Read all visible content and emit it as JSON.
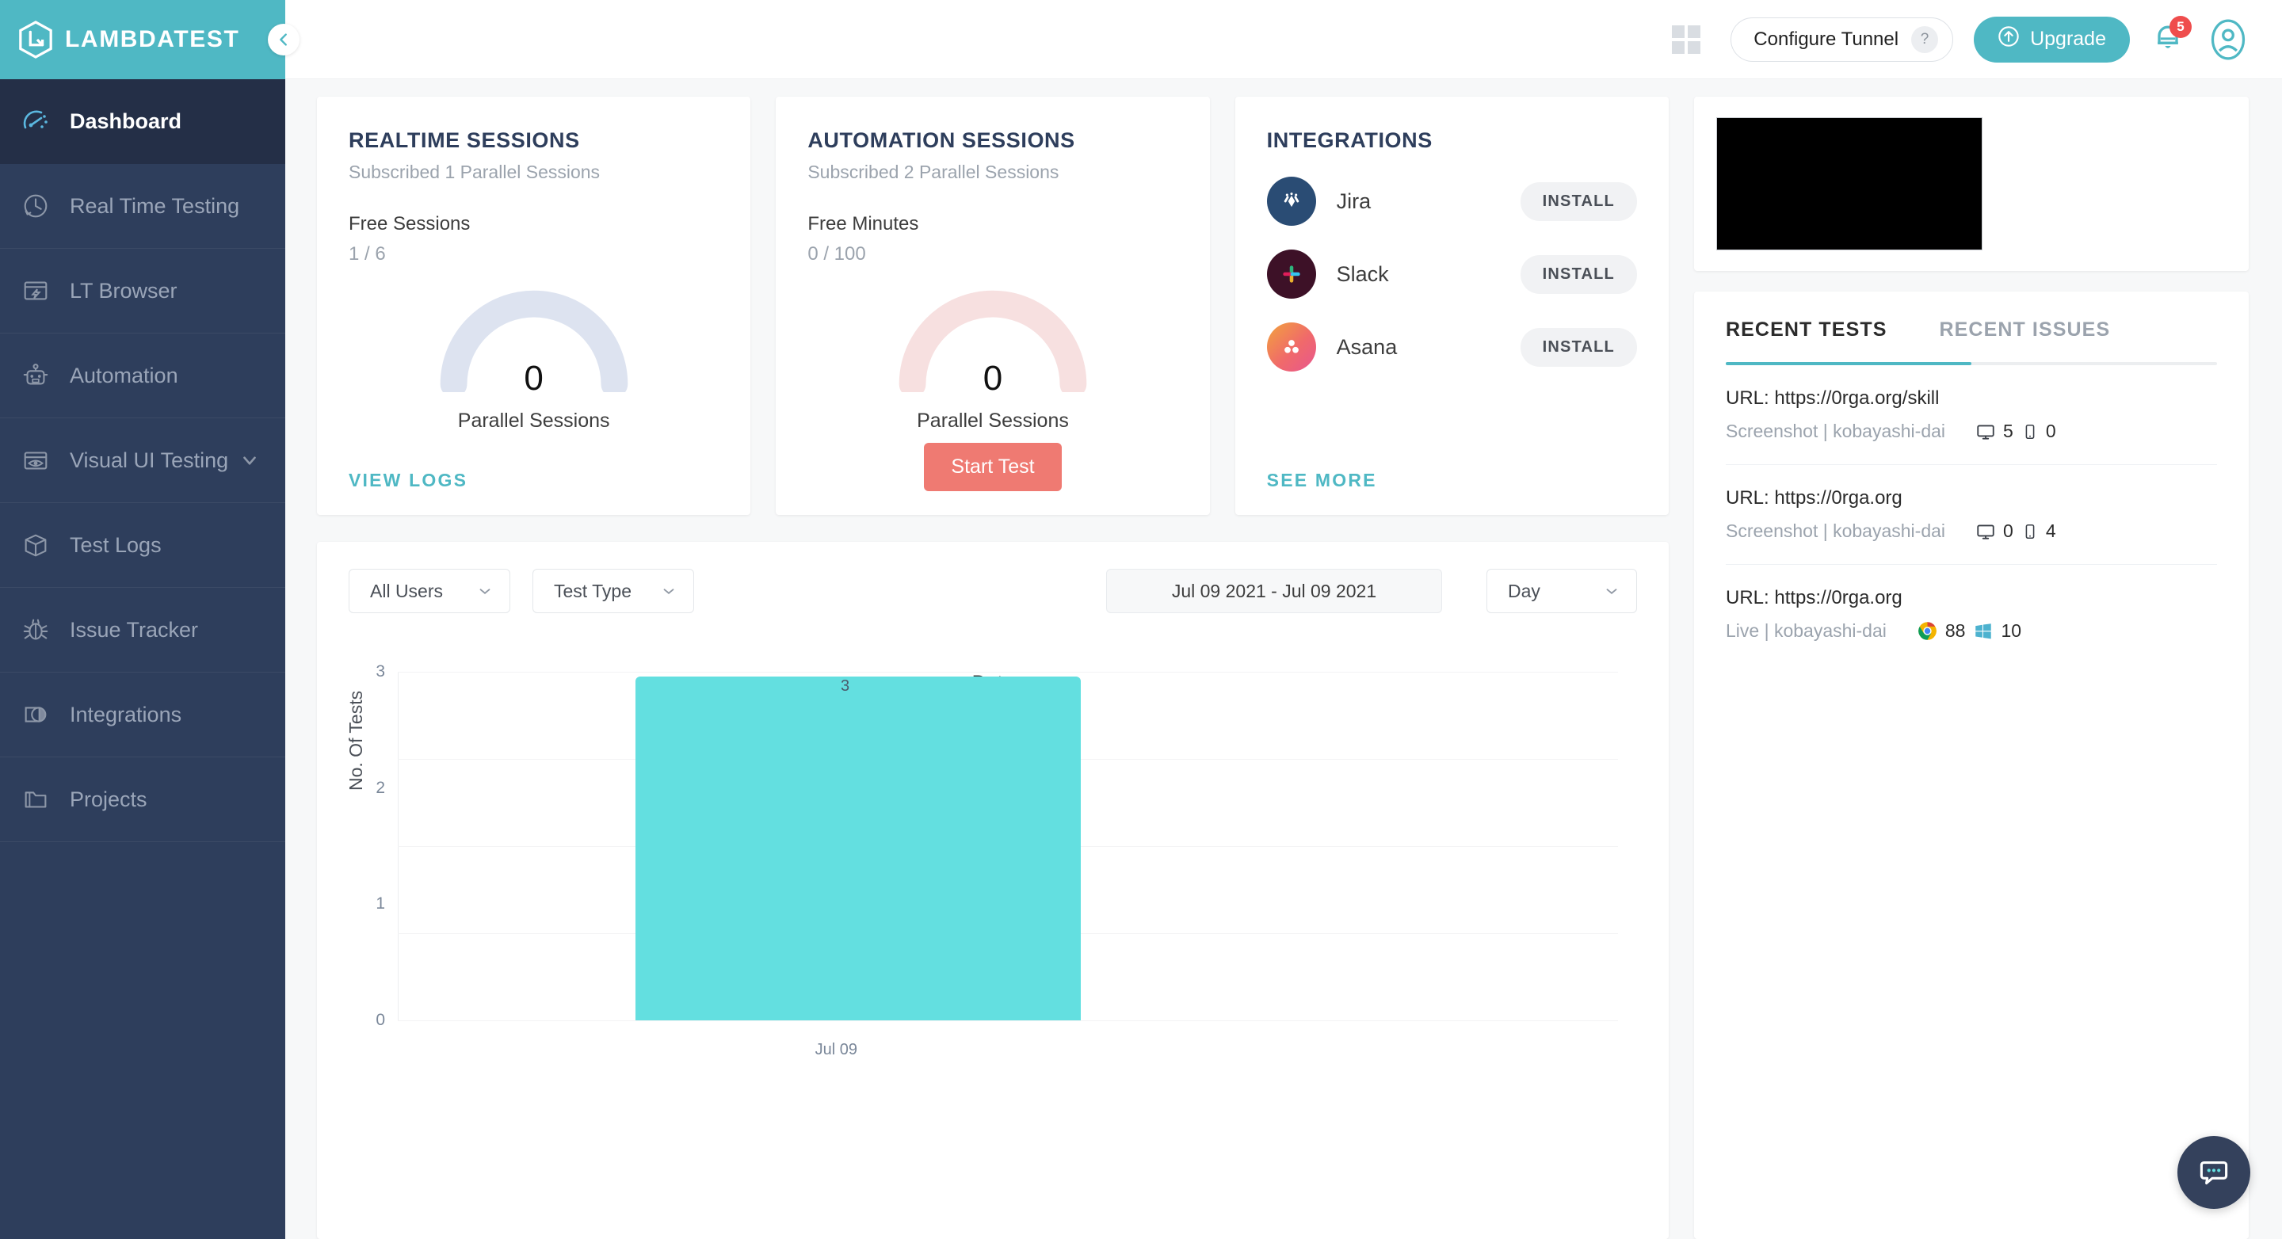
{
  "brand": {
    "name": "LAMBDATEST",
    "logo_icon": "lambdatest-cube-icon",
    "collapse_icon": "chevron-left-icon"
  },
  "sidebar": {
    "items": [
      {
        "label": "Dashboard",
        "icon": "speedometer-icon",
        "active": true
      },
      {
        "label": "Real Time Testing",
        "icon": "clock-icon",
        "active": false
      },
      {
        "label": "LT Browser",
        "icon": "browser-bolt-icon",
        "active": false
      },
      {
        "label": "Automation",
        "icon": "robot-icon",
        "active": false
      },
      {
        "label": "Visual UI Testing",
        "icon": "eye-browser-icon",
        "active": false,
        "caret": "chevron-down-icon"
      },
      {
        "label": "Test Logs",
        "icon": "box-icon",
        "active": false
      },
      {
        "label": "Issue Tracker",
        "icon": "bug-icon",
        "active": false
      },
      {
        "label": "Integrations",
        "icon": "integrations-icon",
        "active": false
      },
      {
        "label": "Projects",
        "icon": "folder-icon",
        "active": false
      }
    ]
  },
  "topbar": {
    "grid_icon": "grid-apps-icon",
    "tunnel_label": "Configure Tunnel",
    "tunnel_help": "?",
    "upgrade_label": "Upgrade",
    "upgrade_icon": "arrow-up-circle-icon",
    "bell_icon": "bell-icon",
    "bell_badge": "5",
    "avatar_icon": "user-avatar-icon",
    "accent_color": "#4fb8c4",
    "badge_color": "#ef4d4d"
  },
  "realtime_card": {
    "title": "REALTIME SESSIONS",
    "subtitle": "Subscribed 1 Parallel Sessions",
    "metric_label": "Free Sessions",
    "metric_value": "1 / 6",
    "gauge_number": "0",
    "gauge_caption": "Parallel Sessions",
    "gauge_color": "#dde3f0",
    "link_label": "VIEW LOGS"
  },
  "automation_card": {
    "title": "AUTOMATION SESSIONS",
    "subtitle": "Subscribed 2 Parallel Sessions",
    "metric_label": "Free Minutes",
    "metric_value": "0 / 100",
    "gauge_number": "0",
    "gauge_caption": "Parallel Sessions",
    "gauge_color": "#f7e0e0",
    "button_label": "Start Test",
    "button_color": "#ef7a72"
  },
  "integrations_card": {
    "title": "INTEGRATIONS",
    "items": [
      {
        "name": "Jira",
        "icon": "jira-logo-icon",
        "action": "INSTALL"
      },
      {
        "name": "Slack",
        "icon": "slack-logo-icon",
        "action": "INSTALL"
      },
      {
        "name": "Asana",
        "icon": "asana-logo-icon",
        "action": "INSTALL"
      }
    ],
    "see_more_label": "SEE MORE"
  },
  "filters": {
    "user_select": "All Users",
    "type_select": "Test Type",
    "date_range": "Jul 09 2021 - Jul 09 2021",
    "granularity": "Day",
    "caret_icon": "chevron-down-icon"
  },
  "chart_data": {
    "type": "bar",
    "categories": [
      "Jul 09"
    ],
    "values": [
      3
    ],
    "data_labels": [
      "3"
    ],
    "title": "",
    "xlabel": "Date",
    "ylabel": "No. Of Tests",
    "ylim": [
      0,
      3
    ],
    "yticks": [
      "0",
      "1",
      "2",
      "3"
    ],
    "grid": true,
    "legend": "none",
    "bar_color": "#63dfe0"
  },
  "right_panel": {
    "banner_icon": "video-thumbnail-placeholder",
    "tabs": [
      {
        "label": "RECENT TESTS",
        "active": true
      },
      {
        "label": "RECENT ISSUES",
        "active": false
      }
    ],
    "tests": [
      {
        "url": "URL: https://0rga.org/skill",
        "sub": "Screenshot | kobayashi-dai",
        "stats": [
          {
            "icon": "desktop-icon",
            "value": "5"
          },
          {
            "icon": "mobile-icon",
            "value": "0"
          }
        ]
      },
      {
        "url": "URL: https://0rga.org",
        "sub": "Screenshot | kobayashi-dai",
        "stats": [
          {
            "icon": "desktop-icon",
            "value": "0"
          },
          {
            "icon": "mobile-icon",
            "value": "4"
          }
        ]
      },
      {
        "url": "URL: https://0rga.org",
        "sub": "Live | kobayashi-dai",
        "stats": [
          {
            "icon": "chrome-logo-icon",
            "value": "88"
          },
          {
            "icon": "windows-logo-icon",
            "value": "10"
          }
        ]
      }
    ]
  },
  "chat": {
    "icon": "chat-bubble-icon"
  }
}
